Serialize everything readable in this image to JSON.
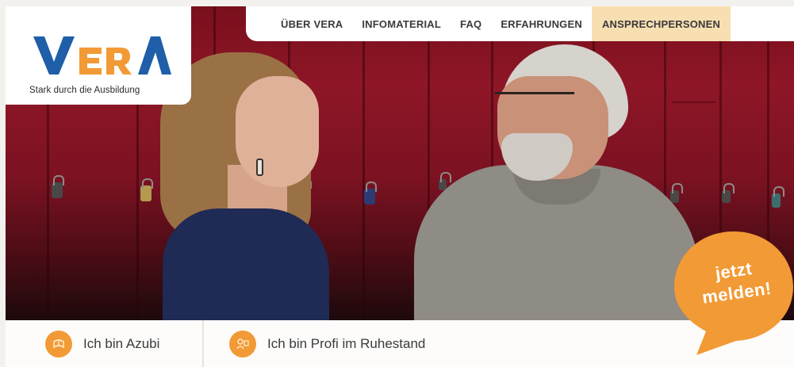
{
  "logo": {
    "wordmark": "VERA",
    "tagline": "Stark durch die Ausbildung",
    "colors": {
      "blue": "#1f5ea8",
      "orange": "#f29a35"
    }
  },
  "nav": {
    "items": [
      {
        "label": "ÜBER VERA"
      },
      {
        "label": "INFOMATERIAL"
      },
      {
        "label": "FAQ"
      },
      {
        "label": "ERFAHRUNGEN"
      },
      {
        "label": "ANSPRECHPERSONEN",
        "active": true
      }
    ]
  },
  "hero": {
    "image": "two-people-talking-at-red-lockers"
  },
  "audience": {
    "items": [
      {
        "label": "Ich bin Azubi",
        "icon": "azubi-icon"
      },
      {
        "label": "Ich bin Profi im Ruhestand",
        "icon": "profi-icon"
      }
    ]
  },
  "cta": {
    "line1": "jetzt",
    "line2": "melden!",
    "color": "#f29a35"
  }
}
